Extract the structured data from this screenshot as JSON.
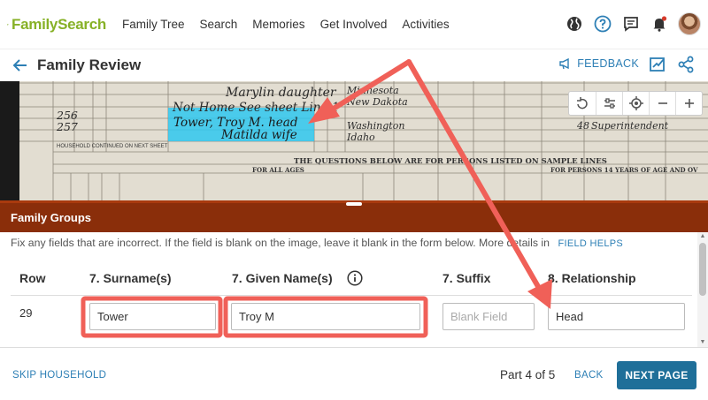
{
  "app": {
    "logo_text": "FamilySearch",
    "nav": [
      "Family Tree",
      "Search",
      "Memories",
      "Get Involved",
      "Activities"
    ]
  },
  "titlebar": {
    "title": "Family Review",
    "feedback_label": "FEEDBACK"
  },
  "record_image": {
    "handwritten_lines": [
      "Marylin  daughter",
      "Not Home  See sheet  Line 1",
      "Tower, Troy M.  head",
      "Matilda  wife"
    ],
    "line_numbers": [
      "256",
      "257"
    ],
    "printed_header": "THE QUESTIONS BELOW ARE FOR PERSONS LISTED ON SAMPLE LINES",
    "printed_subheader": "FOR ALL AGES",
    "printed_right": "FOR PERSONS 14 YEARS OF AGE AND OV",
    "printed_left_note": "HOUSEHOLD CONTINUED ON NEXT SHEET",
    "places": [
      "Minnesota",
      "New Dakota",
      "Washington",
      "Idaho"
    ],
    "occupation": "Superintendent",
    "age_values": [
      "48",
      "48"
    ]
  },
  "groups": {
    "title": "Family Groups",
    "instructions": "Fix any fields that are incorrect. If the field is blank on the image, leave it blank in the form below. More details in",
    "field_helps": "FIELD HELPS"
  },
  "table": {
    "headers": {
      "row": "Row",
      "surname": "7. Surname(s)",
      "given": "7. Given Name(s)",
      "suffix": "7. Suffix",
      "relationship": "8. Relationship"
    },
    "row": {
      "number": "29",
      "surname": "Tower",
      "given": "Troy M",
      "suffix": "",
      "suffix_placeholder": "Blank Field",
      "relationship": "Head"
    }
  },
  "footer": {
    "skip_label": "SKIP HOUSEHOLD",
    "part_label": "Part 4 of 5",
    "back_label": "BACK",
    "next_label": "NEXT PAGE"
  },
  "colors": {
    "brand_green": "#87b127",
    "link_blue": "#2d7fb5",
    "groups_header": "#8a2e0a",
    "next_button": "#1f6f99",
    "highlight": "#2fc8f0",
    "annotation": "#f06058"
  }
}
